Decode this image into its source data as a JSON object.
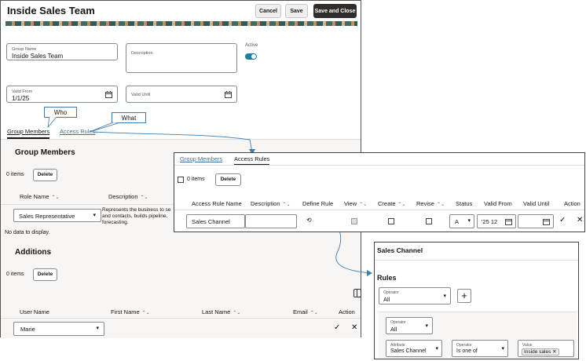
{
  "header": {
    "title": "Inside Sales Team",
    "cancel_label": "Cancel",
    "save_label": "Save",
    "save_close_label": "Save and Close"
  },
  "form": {
    "group_name_label": "Group Name",
    "group_name_value": "Inside Sales Team",
    "description_label": "Description",
    "active_label": "Active",
    "active": true,
    "valid_from_label": "Valid From",
    "valid_from_value": "1/1/25",
    "valid_until_label": "Valid Until"
  },
  "callouts": {
    "who": "Who",
    "what": "What"
  },
  "tabs": {
    "group_members": "Group Members",
    "access_rules": "Access Rules"
  },
  "group_members": {
    "title": "Group Members",
    "items": "0 items",
    "delete_label": "Delete",
    "col_role": "Role Name",
    "col_description": "Description",
    "role_value": "Sales Representative",
    "role_description": "Represents the business to se\nand contacts, builds pipeline,\nforecasting.",
    "no_data": "No data to display."
  },
  "additions": {
    "title": "Additions",
    "items": "0 items",
    "delete_label": "Delete",
    "col_user": "User Name",
    "col_first": "First Name",
    "col_last": "Last Name",
    "col_email": "Email",
    "col_action": "Action",
    "user_value": "Marie"
  },
  "access_panel": {
    "tab_members": "Group Members",
    "tab_rules": "Access Rules",
    "items": "0 items",
    "delete_label": "Delete",
    "columns": {
      "rule_name": "Access Rule Name",
      "description": "Description",
      "define_rule": "Define Rule",
      "view": "View",
      "create": "Create",
      "revise": "Revise",
      "status": "Status",
      "valid_from": "Valid From",
      "valid_until": "Valid Until",
      "action": "Action"
    },
    "row": {
      "rule_name": "Sales Channel",
      "status": "A",
      "valid_from": "'25 12"
    }
  },
  "rule_panel": {
    "title": "Sales Channel",
    "rules_title": "Rules",
    "operator_label": "Operator",
    "operator_value": "All",
    "inner_operator_label": "Operator",
    "inner_operator_value": "All",
    "attribute_label": "Attribute",
    "attribute_value": "Sales Channel",
    "condition_label": "Operator",
    "condition_value": "Is one of",
    "value_label": "Value",
    "value_chip": "Inside sales"
  }
}
